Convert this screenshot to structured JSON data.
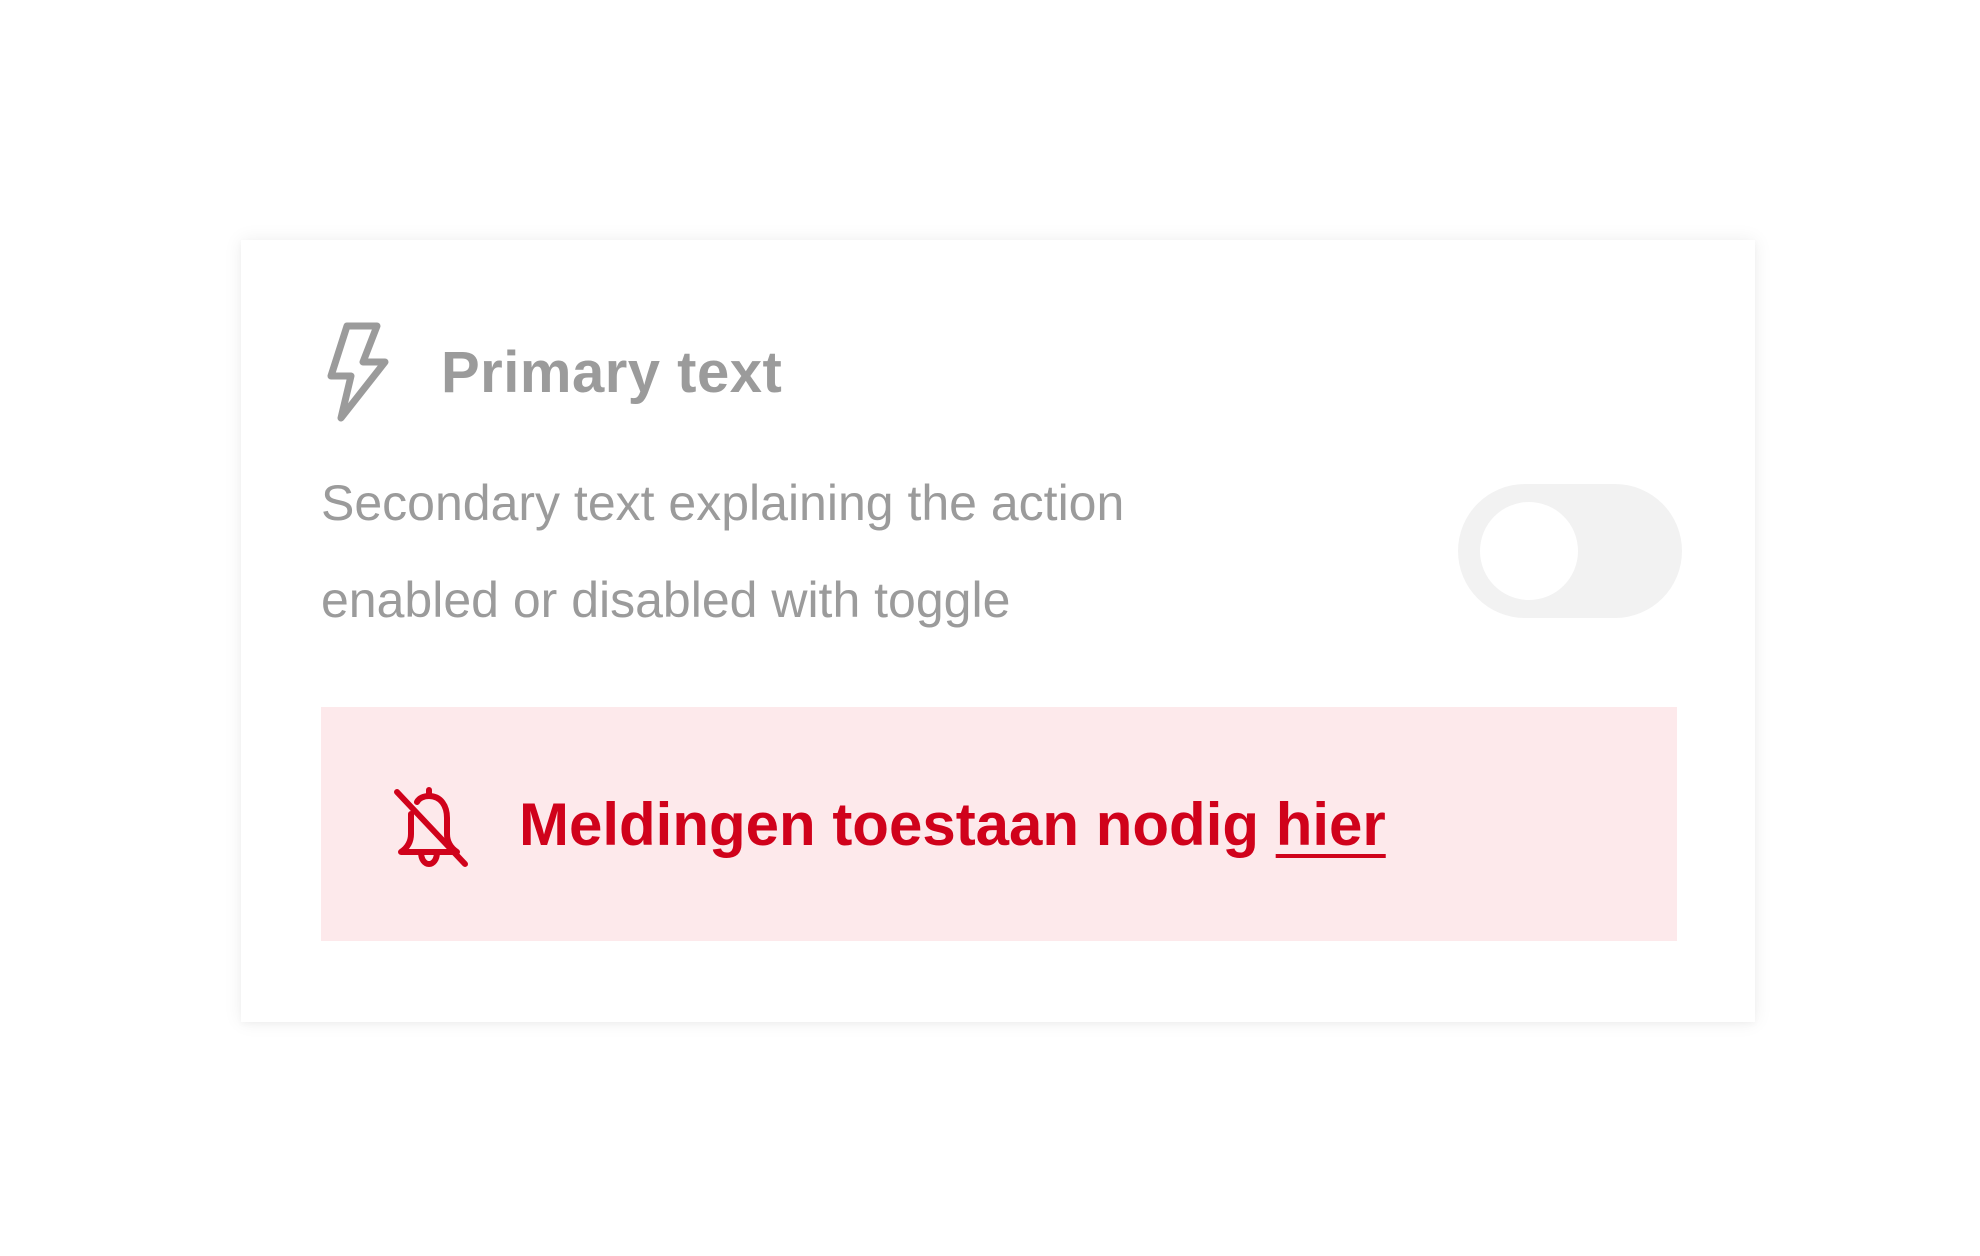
{
  "setting": {
    "icon": "lightning-icon",
    "primary_text": "Primary text",
    "secondary_text_line1": "Secondary text explaining the action",
    "secondary_text_line2": "enabled or disabled with toggle",
    "toggle_state": "off"
  },
  "alert": {
    "icon": "bell-off-icon",
    "message": "Meldingen toestaan nodig ",
    "link_label": "hier"
  },
  "colors": {
    "muted_text": "#9b9b9b",
    "toggle_track": "#f2f2f2",
    "alert_background": "#fde9eb",
    "alert_accent": "#d0021b"
  }
}
